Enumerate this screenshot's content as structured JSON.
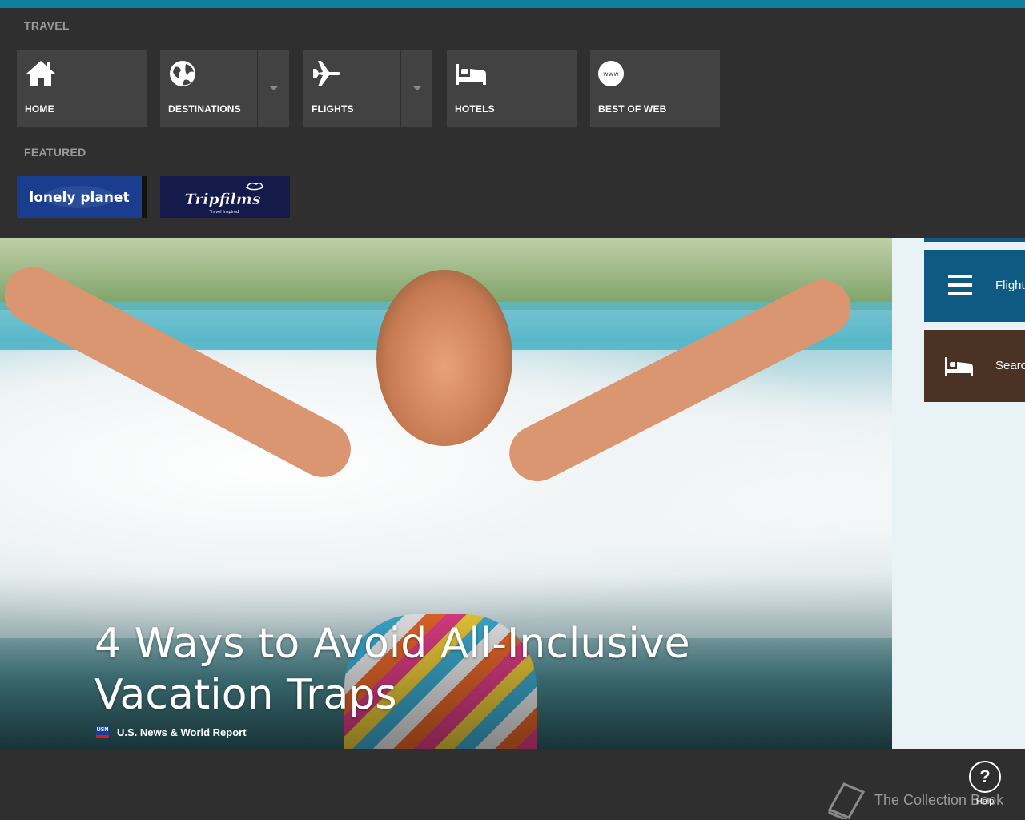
{
  "nav": {
    "travel_label": "TRAVEL",
    "featured_label": "FEATURED",
    "tiles": [
      {
        "label": "HOME",
        "icon": "home-icon",
        "has_dropdown": false
      },
      {
        "label": "DESTINATIONS",
        "icon": "globe-icon",
        "has_dropdown": true
      },
      {
        "label": "FLIGHTS",
        "icon": "airplane-icon",
        "has_dropdown": true
      },
      {
        "label": "HOTELS",
        "icon": "bed-icon",
        "has_dropdown": false
      },
      {
        "label": "BEST OF WEB",
        "icon": "www-icon",
        "has_dropdown": false
      }
    ],
    "featured": [
      {
        "name": "lonely planet",
        "bg": "#1a3d8f"
      },
      {
        "name": "Tripfilms",
        "tagline": "Travel Inspired",
        "bg": "#141a4a"
      }
    ],
    "accent": "#0f7f9b"
  },
  "hero": {
    "title": "4 Ways to Avoid All-Inclusive Vacation Traps",
    "source": "U.S. News & World Report",
    "source_logo_text": "USN"
  },
  "side": {
    "tiles": [
      {
        "label": "Flight",
        "icon": "menu-icon",
        "bg": "#0e5a82"
      },
      {
        "label": "Searc",
        "icon": "bed-icon",
        "bg": "#4a3324"
      }
    ]
  },
  "footer": {
    "collection_label": "The Collection Book",
    "help_symbol": "?",
    "help_label": "Help"
  }
}
